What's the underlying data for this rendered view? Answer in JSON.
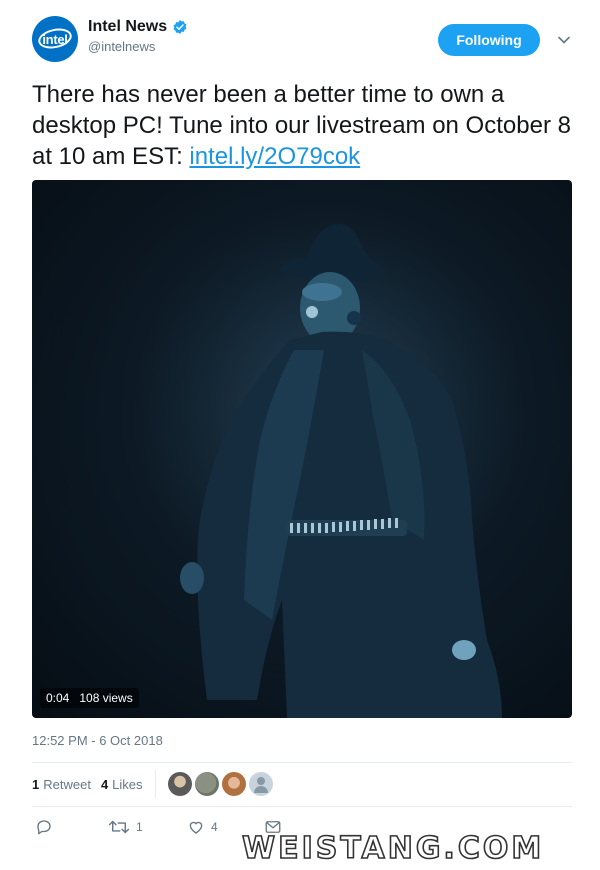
{
  "account": {
    "display_name": "Intel News",
    "handle": "@intelnews",
    "avatar_label": "intel",
    "follow_label": "Following"
  },
  "tweet": {
    "text": "There has never been a better time to own a desktop PC! Tune into our livestream on October 8 at 10 am EST: ",
    "link_text": "intel.ly/2O79cok",
    "timestamp": "12:52 PM - 6 Oct 2018"
  },
  "video": {
    "duration": "0:04",
    "views": "108 views"
  },
  "stats": {
    "retweets_count": "1",
    "retweets_label": "Retweet",
    "likes_count": "4",
    "likes_label": "Likes"
  },
  "actions": {
    "reply_count": "",
    "retweet_count": "1",
    "like_count": "4"
  },
  "watermark": "WEISTANG.COM",
  "colors": {
    "accent": "#1da1f2",
    "link": "#1b95e0",
    "muted": "#657786",
    "brand": "#0071c5"
  },
  "icons": [
    "verified-badge-icon",
    "caret-down-icon",
    "reply-icon",
    "retweet-icon",
    "like-icon",
    "message-icon"
  ]
}
